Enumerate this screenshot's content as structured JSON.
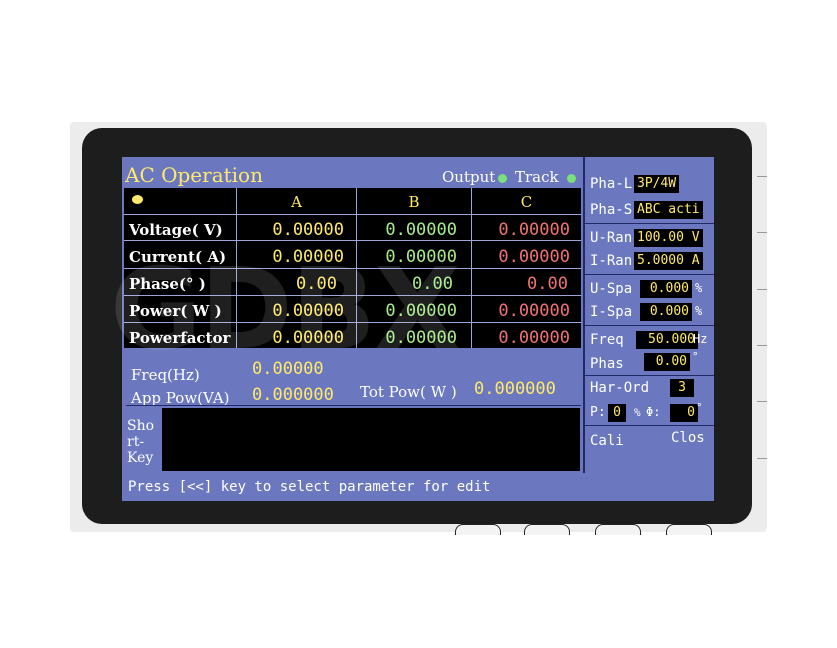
{
  "header": {
    "title": "AC Operation",
    "output_label": "Output",
    "track_label": "Track"
  },
  "table": {
    "columns": [
      "A",
      "B",
      "C"
    ],
    "rows": [
      {
        "label": "Voltage( V)",
        "values": [
          "0.00000",
          "0.00000",
          "0.00000"
        ]
      },
      {
        "label": "Current( A)",
        "values": [
          "0.00000",
          "0.00000",
          "0.00000"
        ]
      },
      {
        "label": "Phase(° )",
        "values": [
          "0.00",
          "0.00",
          "0.00"
        ]
      },
      {
        "label": "Power( W )",
        "values": [
          "0.00000",
          "0.00000",
          "0.00000"
        ]
      },
      {
        "label": "Powerfactor",
        "values": [
          "0.00000",
          "0.00000",
          "0.00000"
        ]
      }
    ]
  },
  "summary": {
    "freq_label": "Freq(Hz)",
    "freq_value": "0.00000",
    "app_pow_label": "App Pow(VA)",
    "app_pow_value": "0.000000",
    "tot_pow_label": "Tot Pow( W )",
    "tot_pow_value": "0.000000"
  },
  "shortkey": {
    "l1": "Sho",
    "l2": "rt-",
    "l3": "Key"
  },
  "status_bar": {
    "text": "Press [<<] key to select parameter for edit"
  },
  "right_panel": {
    "pha_l_label": "Pha-L",
    "pha_l_value": "3P/4W",
    "pha_s_label": "Pha-S",
    "pha_s_value": "ABC acti",
    "u_ran_label": "U-Ran",
    "u_ran_value": "100.00 V",
    "i_ran_label": "I-Ran",
    "i_ran_value": "5.0000 A",
    "u_spa_label": "U-Spa",
    "u_spa_value": "0.000",
    "u_spa_unit": "%",
    "i_spa_label": "I-Spa",
    "i_spa_value": "0.000",
    "i_spa_unit": "%",
    "freq_label": "Freq",
    "freq_value": "50.000",
    "freq_unit": "Hz",
    "phas_label": "Phas",
    "phas_value": "0.00",
    "phas_unit": "°",
    "har_ord_label": "Har-Ord",
    "har_ord_value": "3",
    "p_label": "P:",
    "p_value": "0",
    "pct_label": "%",
    "phi_label": "Φ:",
    "phi_value": "0",
    "phi_unit": "°",
    "cali_label": "Cali",
    "clos_label": "Clos"
  },
  "watermark": "GDBX",
  "colors": {
    "screen_bg": "#6b78bf",
    "panel_bg": "#000000",
    "value_yellow": "#ffe96a",
    "value_green": "#a6ec8a",
    "value_red": "#f07272",
    "led_green": "#79e07a"
  }
}
